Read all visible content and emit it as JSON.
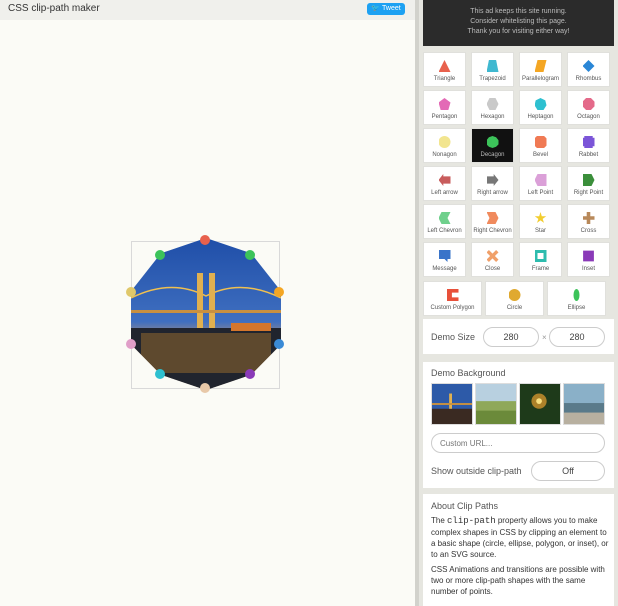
{
  "header": {
    "title": "CSS clip-path maker",
    "tweet_label": "Tweet"
  },
  "ad": {
    "lines": [
      "This ad keeps this site running.",
      "Consider whitelisting this page.",
      "Thank you for visiting either way!"
    ]
  },
  "shapes": [
    {
      "label": "Triangle",
      "color": "#e8614d"
    },
    {
      "label": "Trapezoid",
      "color": "#3fb8d0"
    },
    {
      "label": "Parallelogram",
      "color": "#f4a623"
    },
    {
      "label": "Rhombus",
      "color": "#2a86d6"
    },
    {
      "label": "Pentagon",
      "color": "#e36ab6"
    },
    {
      "label": "Hexagon",
      "color": "#c9c9c9"
    },
    {
      "label": "Heptagon",
      "color": "#2ec0d0"
    },
    {
      "label": "Octagon",
      "color": "#e46a8a"
    },
    {
      "label": "Nonagon",
      "color": "#f2e58f"
    },
    {
      "label": "Decagon",
      "color": "#3cc35a"
    },
    {
      "label": "Bevel",
      "color": "#f07a54"
    },
    {
      "label": "Rabbet",
      "color": "#7b55d8"
    },
    {
      "label": "Left arrow",
      "color": "#c85c5c"
    },
    {
      "label": "Right arrow",
      "color": "#777777"
    },
    {
      "label": "Left Point",
      "color": "#dba0d8"
    },
    {
      "label": "Right Point",
      "color": "#3b8f3b"
    },
    {
      "label": "Left Chevron",
      "color": "#6fd08c"
    },
    {
      "label": "Right Chevron",
      "color": "#f08a5d"
    },
    {
      "label": "Star",
      "color": "#f2cd2f"
    },
    {
      "label": "Cross",
      "color": "#b8895a"
    },
    {
      "label": "Message",
      "color": "#3a74c9"
    },
    {
      "label": "Close",
      "color": "#f0a06a"
    },
    {
      "label": "Frame",
      "color": "#2ebcae"
    },
    {
      "label": "Inset",
      "color": "#8a3ab8"
    },
    {
      "label": "Custom Polygon",
      "color": "#e8503a"
    },
    {
      "label": "Circle",
      "color": "#e0a92f"
    },
    {
      "label": "Ellipse",
      "color": "#3cc35a"
    }
  ],
  "selected_shape": "Decagon",
  "demo_size": {
    "label": "Demo Size",
    "width": "280",
    "height": "280",
    "separator": "×"
  },
  "demo_background": {
    "label": "Demo Background",
    "url_placeholder": "Custom URL..."
  },
  "show_outside": {
    "label": "Show outside clip-path",
    "value": "Off"
  },
  "about": {
    "title": "About Clip Paths",
    "para1_pre": "The ",
    "para1_code": "clip-path",
    "para1_post": " property allows you to make complex shapes in CSS by clipping an element to a basic shape (circle, ellipse, polygon, or inset), or to an SVG source.",
    "para2": "CSS Animations and transitions are possible with two or more clip-path shapes with the same number of points."
  },
  "handle_colors": [
    "#e8614d",
    "#3cc35a",
    "#3cc35a",
    "#e0c86a",
    "#f4a623",
    "#e09ec8",
    "#3a8ad6",
    "#2ec0d0",
    "#8a3ab8",
    "#e8c8a8"
  ]
}
